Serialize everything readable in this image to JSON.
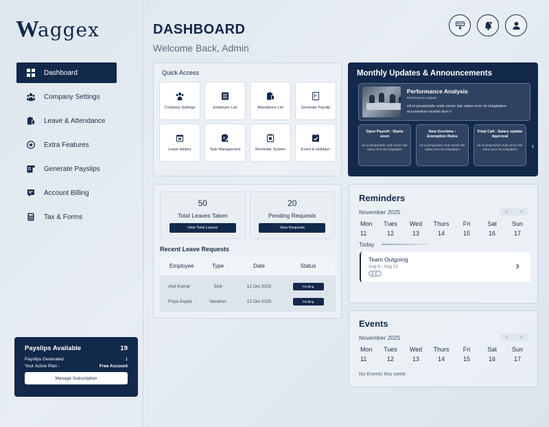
{
  "brand": {
    "logo_initial": "W",
    "logo_rest": "aggex"
  },
  "sidebar": {
    "items": [
      {
        "label": "Dashboard",
        "icon": "dashboard-icon",
        "active": true
      },
      {
        "label": "Company Settings",
        "icon": "users-icon",
        "active": false
      },
      {
        "label": "Leave & Attendance",
        "icon": "clipboard-icon",
        "active": false
      },
      {
        "label": "Extra Features",
        "icon": "star-icon",
        "active": false
      },
      {
        "label": "Generate Payslips",
        "icon": "document-icon",
        "active": false
      },
      {
        "label": "Account Billing",
        "icon": "receipt-icon",
        "active": false
      },
      {
        "label": "Tax & Forms",
        "icon": "calculator-icon",
        "active": false
      }
    ]
  },
  "payslips": {
    "title": "Payslips Available",
    "count": "19",
    "generated_label": "Payslips Generated :",
    "generated_value": "1",
    "plan_label": "Your Active Plan :",
    "plan_value": "Free Account",
    "button": "Manage Subscription"
  },
  "header": {
    "title": "DASHBOARD",
    "welcome": "Welcome Back, Admin",
    "help_label": "HELP",
    "icons": [
      "help-icon",
      "bell-icon",
      "user-icon"
    ]
  },
  "quick_access": {
    "title": "Quick Access",
    "tiles": [
      {
        "label": "Company Settings",
        "icon": "users-icon"
      },
      {
        "label": "Employee List",
        "icon": "list-icon"
      },
      {
        "label": "Attendance List",
        "icon": "clipboard-icon"
      },
      {
        "label": "Generate Payslip",
        "icon": "payslip-icon"
      },
      {
        "label": "Leave History",
        "icon": "calendar-x-icon"
      },
      {
        "label": "Task Management",
        "icon": "task-icon"
      },
      {
        "label": "Reminder System",
        "icon": "alarm-icon"
      },
      {
        "label": "Event & Holidays",
        "icon": "calendar-check-icon"
      }
    ]
  },
  "announcements": {
    "title": "Monthly Updates & Announcements",
    "featured": {
      "title": "Performance Analysis",
      "subtitle": "Performance Analysis",
      "body": "ed ut perspiciatis unde omnis iste natus error sit voluptatem accusantium laudan tium n"
    },
    "cards": [
      {
        "title": "Open Payroll : Starts soon",
        "body": "ed ut perspiciatis unde omnis iste natus error sit voluptatem"
      },
      {
        "title": "New Overtime : Exemption Rules",
        "body": "ed ut perspiciatis unde omnis iste natus error sit voluptatem"
      },
      {
        "title": "Final Call : Salary update Approval",
        "body": "ed ut perspiciatis unde omnis iste natus error sit voluptatem"
      }
    ]
  },
  "leaves": {
    "total": {
      "value": "50",
      "label": "Total Leaves Taken",
      "button": "View Total Leaves"
    },
    "pending": {
      "value": "20",
      "label": "Pending Requests",
      "button": "View Requests"
    },
    "recent_title": "Recent Leave Requests",
    "columns": [
      "Employee",
      "Type",
      "Date",
      "Status"
    ],
    "rows": [
      {
        "employee": "Atul Kumar",
        "type": "Sick",
        "date": "12 Oct 2025",
        "status": "Pending"
      },
      {
        "employee": "Priya Gupta",
        "type": "Vacation",
        "date": "12 Oct 2025",
        "status": "Pending"
      }
    ]
  },
  "reminders": {
    "title": "Reminders",
    "month": "November 2025",
    "days": [
      "Mon",
      "Tues",
      "Wed",
      "Thurs",
      "Fri",
      "Sat",
      "Sun"
    ],
    "dates": [
      "11",
      "12",
      "13",
      "14",
      "15",
      "16",
      "17"
    ],
    "today_label": "Today",
    "event": {
      "title": "Team Outgoing",
      "dates": "Aug 6 - Aug 12"
    }
  },
  "events": {
    "title": "Events",
    "month": "November 2025",
    "days": [
      "Mon",
      "Tues",
      "Wed",
      "Thurs",
      "Fri",
      "Sat",
      "Sun"
    ],
    "dates": [
      "11",
      "12",
      "13",
      "14",
      "15",
      "16",
      "17"
    ],
    "empty": "No Events this week"
  },
  "colors": {
    "primary": "#13294b",
    "background": "#e3e9ef",
    "card": "#ffffff"
  }
}
